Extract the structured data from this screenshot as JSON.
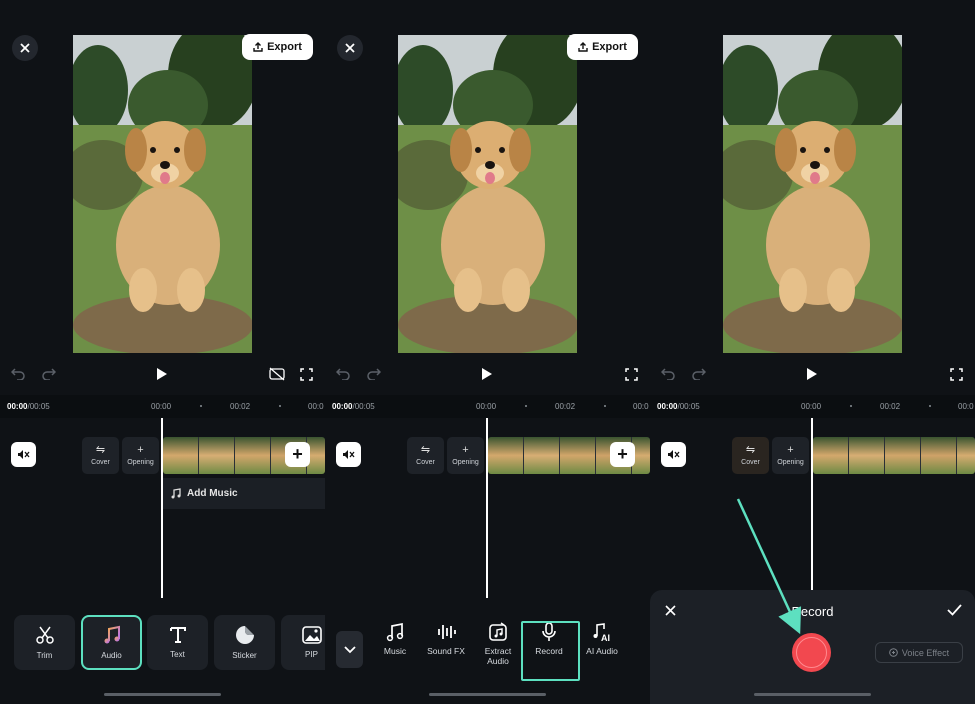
{
  "colors": {
    "background": "#0f1216",
    "highlight": "#5de0c0",
    "record": "#f2484f"
  },
  "editor": {
    "export_label": "Export",
    "time_current": "00:00",
    "time_total": "/00:05",
    "ticks": [
      "00:00",
      "00:02",
      "00:0"
    ],
    "cover_label": "Cover",
    "opening_label": "Opening",
    "add_music_label": "Add Music"
  },
  "toolbar1": [
    {
      "label": "Trim",
      "icon": "scissors-icon"
    },
    {
      "label": "Audio",
      "icon": "music-note-icon",
      "highlighted": true
    },
    {
      "label": "Text",
      "icon": "text-icon"
    },
    {
      "label": "Sticker",
      "icon": "sticker-icon"
    },
    {
      "label": "PIP",
      "icon": "picture-icon"
    }
  ],
  "toolbar2": [
    {
      "label": "Music",
      "icon": "music-notes-icon"
    },
    {
      "label": "Sound FX",
      "icon": "sound-fx-icon"
    },
    {
      "label": "Extract Audio",
      "icon": "extract-audio-icon"
    },
    {
      "label": "Record",
      "icon": "microphone-icon",
      "highlighted": true
    },
    {
      "label": "AI Audio",
      "icon": "ai-audio-icon"
    }
  ],
  "record_sheet": {
    "title": "Record",
    "voice_effect_label": "Voice Effect"
  }
}
